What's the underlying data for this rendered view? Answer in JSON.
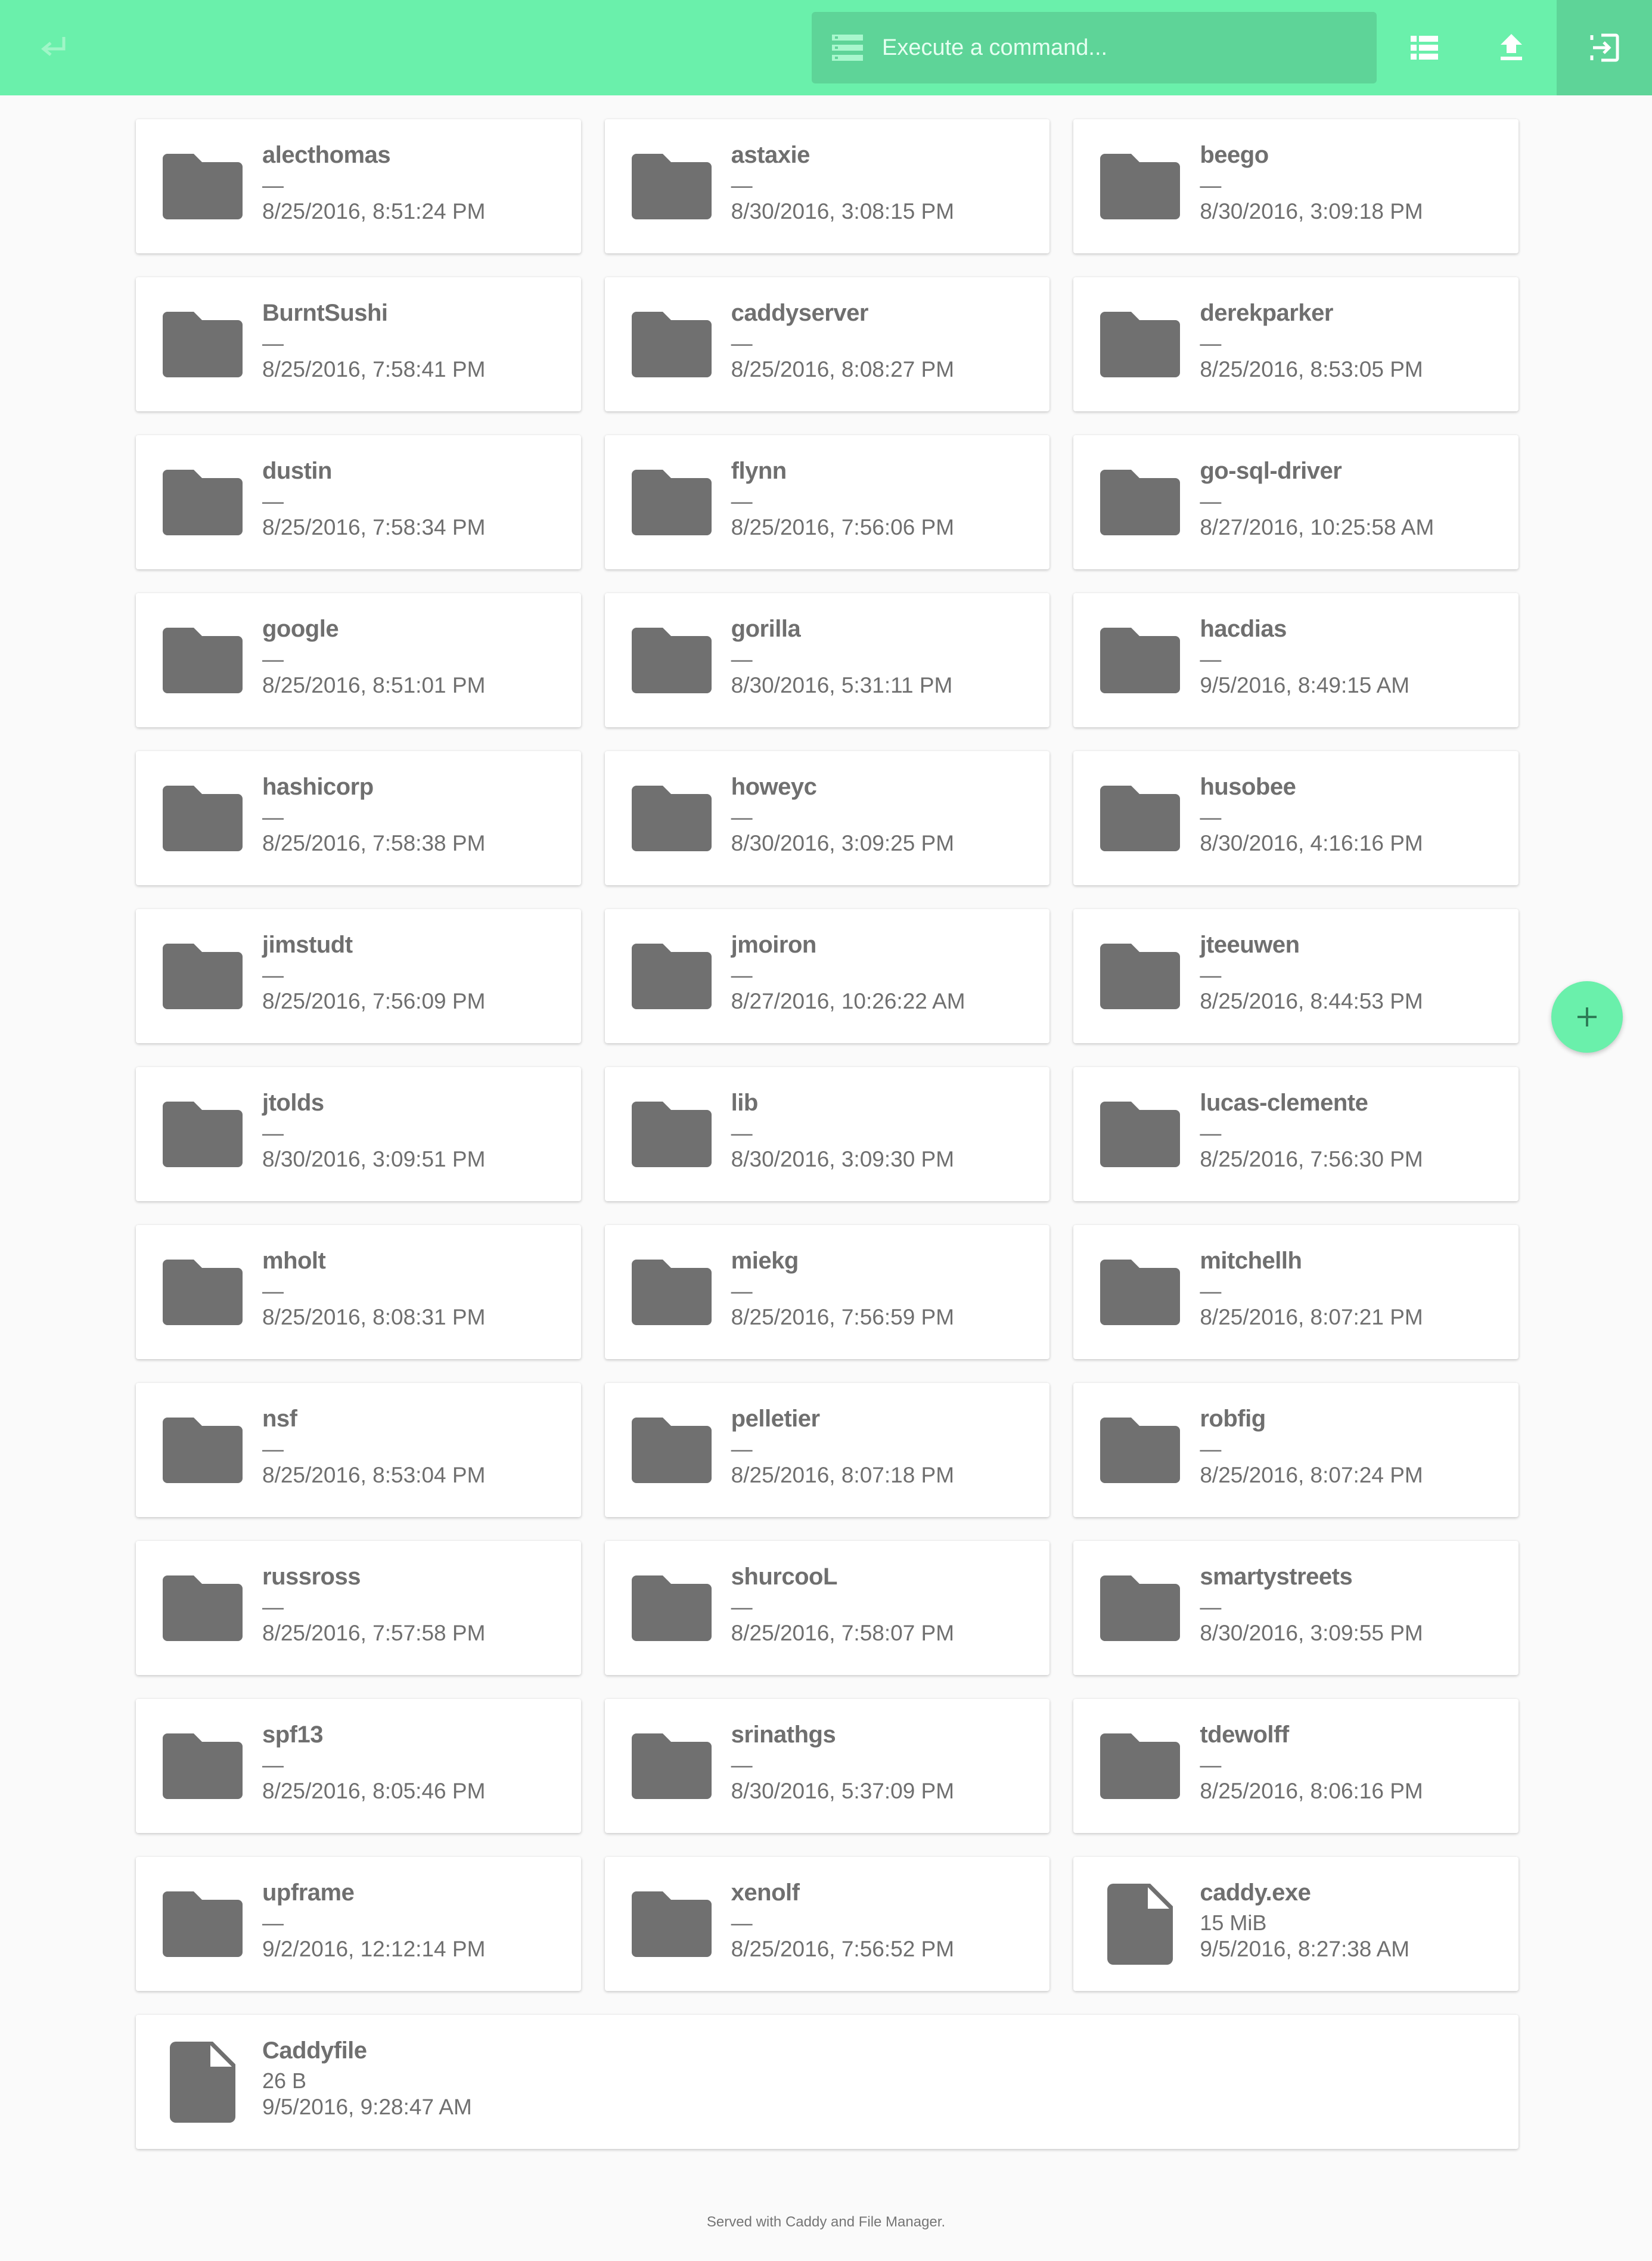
{
  "header": {
    "search": {
      "placeholder": "Execute a command...",
      "value": ""
    },
    "accent_color": "#6af0ab",
    "icons": {
      "back": "return-arrow-icon",
      "search": "command-list-icon",
      "view": "list-view-icon",
      "upload": "upload-icon",
      "logout": "logout-icon"
    }
  },
  "listing": {
    "rows": [
      [
        {
          "name": "alecthomas",
          "size": "—",
          "modified": "8/25/2016, 8:51:24 PM",
          "type": "folder"
        },
        {
          "name": "astaxie",
          "size": "—",
          "modified": "8/30/2016, 3:08:15 PM",
          "type": "folder"
        },
        {
          "name": "beego",
          "size": "—",
          "modified": "8/30/2016, 3:09:18 PM",
          "type": "folder"
        }
      ],
      [
        {
          "name": "BurntSushi",
          "size": "—",
          "modified": "8/25/2016, 7:58:41 PM",
          "type": "folder"
        },
        {
          "name": "caddyserver",
          "size": "—",
          "modified": "8/25/2016, 8:08:27 PM",
          "type": "folder"
        },
        {
          "name": "derekparker",
          "size": "—",
          "modified": "8/25/2016, 8:53:05 PM",
          "type": "folder"
        }
      ],
      [
        {
          "name": "dustin",
          "size": "—",
          "modified": "8/25/2016, 7:58:34 PM",
          "type": "folder"
        },
        {
          "name": "flynn",
          "size": "—",
          "modified": "8/25/2016, 7:56:06 PM",
          "type": "folder"
        },
        {
          "name": "go-sql-driver",
          "size": "—",
          "modified": "8/27/2016, 10:25:58 AM",
          "type": "folder"
        }
      ],
      [
        {
          "name": "google",
          "size": "—",
          "modified": "8/25/2016, 8:51:01 PM",
          "type": "folder"
        },
        {
          "name": "gorilla",
          "size": "—",
          "modified": "8/30/2016, 5:31:11 PM",
          "type": "folder"
        },
        {
          "name": "hacdias",
          "size": "—",
          "modified": "9/5/2016, 8:49:15 AM",
          "type": "folder"
        }
      ],
      [
        {
          "name": "hashicorp",
          "size": "—",
          "modified": "8/25/2016, 7:58:38 PM",
          "type": "folder"
        },
        {
          "name": "howeyc",
          "size": "—",
          "modified": "8/30/2016, 3:09:25 PM",
          "type": "folder"
        },
        {
          "name": "husobee",
          "size": "—",
          "modified": "8/30/2016, 4:16:16 PM",
          "type": "folder"
        }
      ],
      [
        {
          "name": "jimstudt",
          "size": "—",
          "modified": "8/25/2016, 7:56:09 PM",
          "type": "folder"
        },
        {
          "name": "jmoiron",
          "size": "—",
          "modified": "8/27/2016, 10:26:22 AM",
          "type": "folder"
        },
        {
          "name": "jteeuwen",
          "size": "—",
          "modified": "8/25/2016, 8:44:53 PM",
          "type": "folder"
        }
      ],
      [
        {
          "name": "jtolds",
          "size": "—",
          "modified": "8/30/2016, 3:09:51 PM",
          "type": "folder"
        },
        {
          "name": "lib",
          "size": "—",
          "modified": "8/30/2016, 3:09:30 PM",
          "type": "folder"
        },
        {
          "name": "lucas-clemente",
          "size": "—",
          "modified": "8/25/2016, 7:56:30 PM",
          "type": "folder"
        }
      ],
      [
        {
          "name": "mholt",
          "size": "—",
          "modified": "8/25/2016, 8:08:31 PM",
          "type": "folder"
        },
        {
          "name": "miekg",
          "size": "—",
          "modified": "8/25/2016, 7:56:59 PM",
          "type": "folder"
        },
        {
          "name": "mitchellh",
          "size": "—",
          "modified": "8/25/2016, 8:07:21 PM",
          "type": "folder"
        }
      ],
      [
        {
          "name": "nsf",
          "size": "—",
          "modified": "8/25/2016, 8:53:04 PM",
          "type": "folder"
        },
        {
          "name": "pelletier",
          "size": "—",
          "modified": "8/25/2016, 8:07:18 PM",
          "type": "folder"
        },
        {
          "name": "robfig",
          "size": "—",
          "modified": "8/25/2016, 8:07:24 PM",
          "type": "folder"
        }
      ],
      [
        {
          "name": "russross",
          "size": "—",
          "modified": "8/25/2016, 7:57:58 PM",
          "type": "folder"
        },
        {
          "name": "shurcooL",
          "size": "—",
          "modified": "8/25/2016, 7:58:07 PM",
          "type": "folder"
        },
        {
          "name": "smartystreets",
          "size": "—",
          "modified": "8/30/2016, 3:09:55 PM",
          "type": "folder"
        }
      ],
      [
        {
          "name": "spf13",
          "size": "—",
          "modified": "8/25/2016, 8:05:46 PM",
          "type": "folder"
        },
        {
          "name": "srinathgs",
          "size": "—",
          "modified": "8/30/2016, 5:37:09 PM",
          "type": "folder"
        },
        {
          "name": "tdewolff",
          "size": "—",
          "modified": "8/25/2016, 8:06:16 PM",
          "type": "folder"
        }
      ],
      [
        {
          "name": "upframe",
          "size": "—",
          "modified": "9/2/2016, 12:12:14 PM",
          "type": "folder"
        },
        {
          "name": "xenolf",
          "size": "—",
          "modified": "8/25/2016, 7:56:52 PM",
          "type": "folder"
        },
        {
          "name": "caddy.exe",
          "size": "15 MiB",
          "modified": "9/5/2016, 8:27:38 AM",
          "type": "file"
        }
      ],
      [
        {
          "name": "Caddyfile",
          "size": "26 B",
          "modified": "9/5/2016, 9:28:47 AM",
          "type": "file"
        }
      ]
    ]
  },
  "fab": {
    "icon": "plus-icon"
  },
  "footer": {
    "text": "Served with Caddy and File Manager."
  }
}
